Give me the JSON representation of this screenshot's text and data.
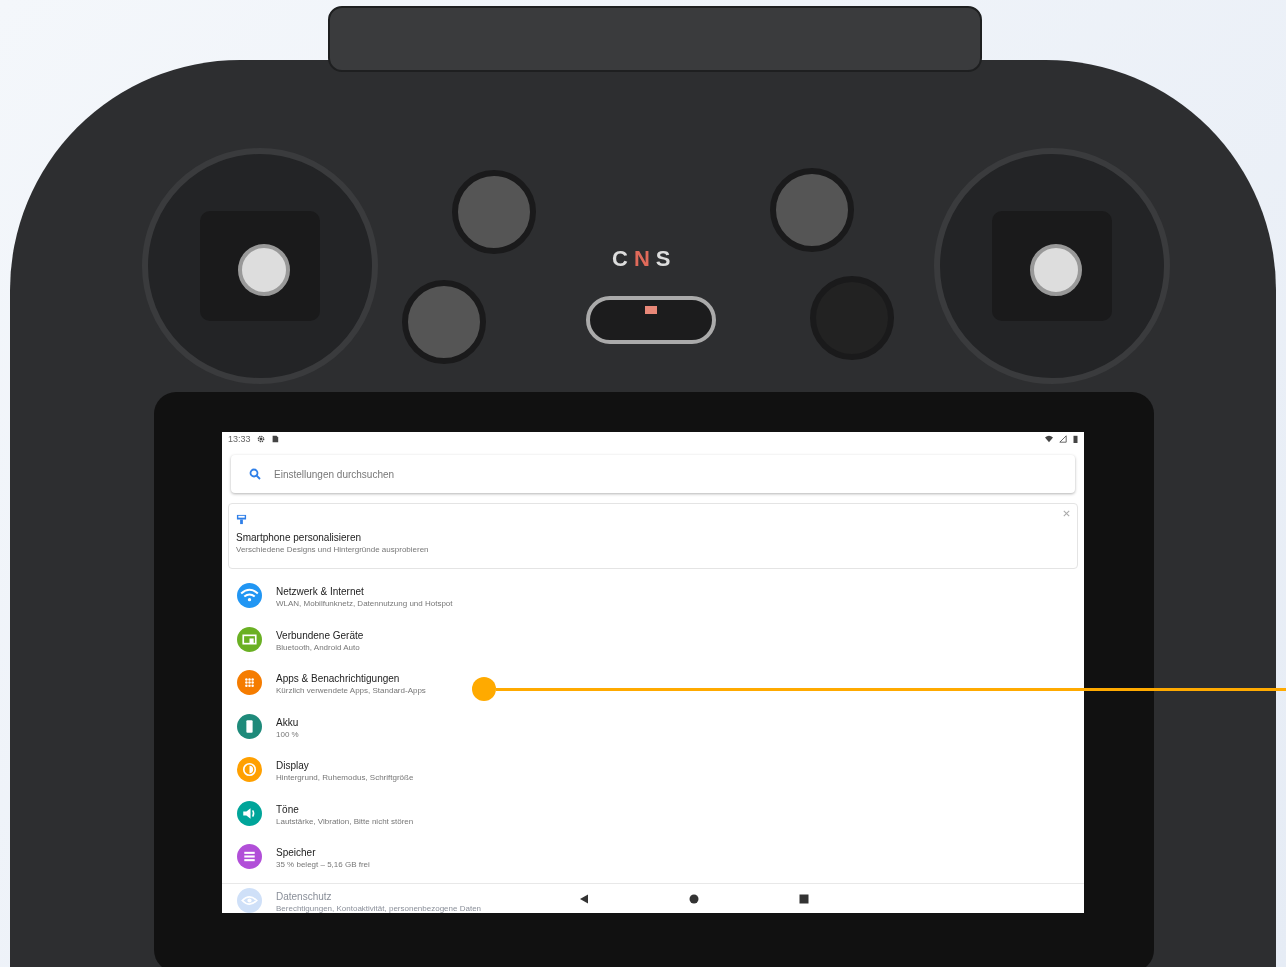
{
  "device": {
    "mode_switch": [
      {
        "label": "C",
        "selected": false
      },
      {
        "label": "N",
        "selected": true
      },
      {
        "label": "S",
        "selected": false
      }
    ]
  },
  "status_bar": {
    "time": "13:33"
  },
  "search": {
    "placeholder": "Einstellungen durchsuchen"
  },
  "suggestion": {
    "title": "Smartphone personalisieren",
    "subtitle": "Verschiedene Designs und Hintergründe ausprobieren"
  },
  "settings": [
    {
      "kind": "wifi",
      "title": "Netzwerk & Internet",
      "subtitle": "WLAN, Mobilfunknetz, Datennutzung und Hotspot",
      "color": "#2196f3"
    },
    {
      "kind": "devices",
      "title": "Verbundene Geräte",
      "subtitle": "Bluetooth, Android Auto",
      "color": "#6ab023"
    },
    {
      "kind": "apps",
      "title": "Apps & Benachrichtigungen",
      "subtitle": "Kürzlich verwendete Apps, Standard-Apps",
      "color": "#f57c00"
    },
    {
      "kind": "battery",
      "title": "Akku",
      "subtitle": "100 %",
      "color": "#1e8a7a"
    },
    {
      "kind": "display",
      "title": "Display",
      "subtitle": "Hintergrund, Ruhemodus, Schriftgröße",
      "color": "#ffa000"
    },
    {
      "kind": "sound",
      "title": "Töne",
      "subtitle": "Lautstärke, Vibration, Bitte nicht stören",
      "color": "#00a59a"
    },
    {
      "kind": "storage",
      "title": "Speicher",
      "subtitle": "35 % belegt – 5,16 GB frei",
      "color": "#b14fd8"
    },
    {
      "kind": "privacy",
      "title": "Datenschutz",
      "subtitle": "Berechtigungen, Kontoaktivität, personenbezogene Daten",
      "color": "#cfe0f8"
    }
  ]
}
